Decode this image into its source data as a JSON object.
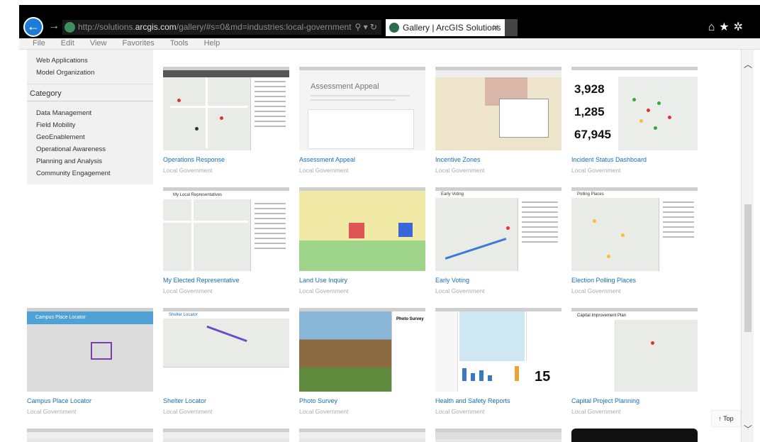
{
  "browser": {
    "url_prefix": "http://solutions.",
    "url_host": "arcgis.com",
    "url_path": "/gallery/#s=0&md=industries:local-government",
    "addr_icons": "⚲ ▾ ↻",
    "tab_title": "Gallery | ArcGIS Solutions",
    "tab_close": "✕",
    "back_glyph": "←",
    "forward_glyph": "→",
    "right_icons": "⌂★✲"
  },
  "menu": [
    "File",
    "Edit",
    "View",
    "Favorites",
    "Tools",
    "Help"
  ],
  "sidebar": {
    "top_links": [
      "Web Applications",
      "Model Organization"
    ],
    "category_title": "Category",
    "categories": [
      "Data Management",
      "Field Mobility",
      "GeoEnablement",
      "Operational Awareness",
      "Planning and Analysis",
      "Community Engagement"
    ]
  },
  "gallery": {
    "subtitle": "Local Government",
    "cards": [
      {
        "title": "Operations Response",
        "app": "Operations Response"
      },
      {
        "title": "Assessment Appeal",
        "app": "Assessment Appeal"
      },
      {
        "title": "Incentive Zones",
        "app": ""
      },
      {
        "title": "Incident Status Dashboard",
        "app": "",
        "stats": [
          "3,928",
          "1,285",
          "67,945"
        ]
      },
      {
        "title": "My Elected Representative",
        "app": "My Local Representatives"
      },
      {
        "title": "Land Use Inquiry",
        "app": ""
      },
      {
        "title": "Early Voting",
        "app": "Early Voting"
      },
      {
        "title": "Election Polling Places",
        "app": "Polling Places"
      },
      {
        "title": "Campus Place Locator",
        "app": "Campus Place Locator"
      },
      {
        "title": "Shelter Locator",
        "app": "Shelter Locator"
      },
      {
        "title": "Photo Survey",
        "app": "Photo Survey"
      },
      {
        "title": "Health and Safety Reports",
        "app": "",
        "stats": [
          "15"
        ]
      },
      {
        "title": "Capital Project Planning",
        "app": "Capital Improvement Plan"
      }
    ]
  },
  "controls": {
    "top_label": "Top",
    "top_glyph": "🠕"
  }
}
